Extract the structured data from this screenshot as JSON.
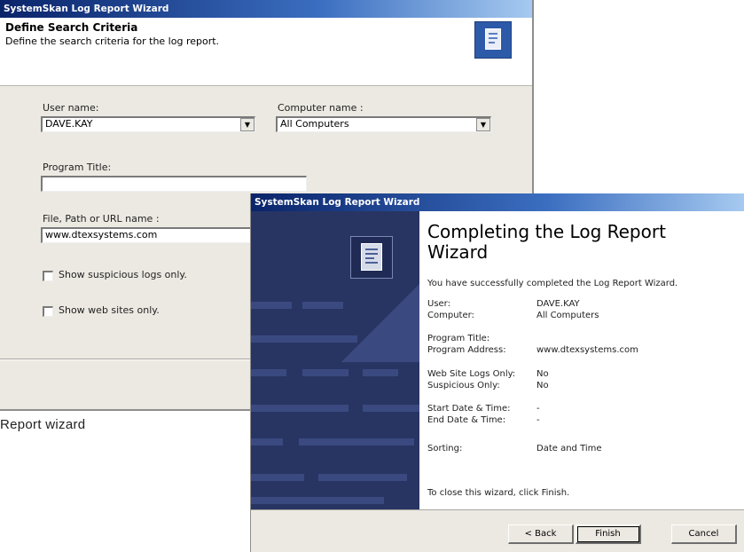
{
  "window1": {
    "title": "SystemSkan Log Report Wizard",
    "heading": "Define Search Criteria",
    "subheading": "Define the search criteria for the log report.",
    "logo_icon": "document-report-icon",
    "user_name": {
      "label": "User name:",
      "value": "DAVE.KAY"
    },
    "computer_name": {
      "label": "Computer name :",
      "value": "All Computers"
    },
    "program_title": {
      "label": "Program Title:",
      "value": ""
    },
    "url_name": {
      "label": "File, Path or URL name :",
      "value": "www.dtexsystems.com"
    },
    "checkboxes": [
      {
        "label": "Show suspicious logs only.",
        "checked": false
      },
      {
        "label": "Show web sites only.",
        "checked": false
      }
    ],
    "dropdown_arrow": "▼"
  },
  "caption": "Report wizard",
  "window2": {
    "title": "SystemSkan Log Report Wizard",
    "heading_line1": "Completing the Log Report",
    "heading_line2": "Wizard",
    "intro": "You have successfully completed the Log Report Wizard.",
    "summary": [
      {
        "label": "User:",
        "value": "DAVE.KAY"
      },
      {
        "label": "Computer:",
        "value": "All Computers"
      },
      {
        "label": "Program Title:",
        "value": ""
      },
      {
        "label": "Program Address:",
        "value": "www.dtexsystems.com"
      },
      {
        "label": "Web Site Logs Only:",
        "value": "No"
      },
      {
        "label": "Suspicious Only:",
        "value": "No"
      },
      {
        "label": "Start Date & Time:",
        "value": "-"
      },
      {
        "label": "End Date & Time:",
        "value": "-"
      },
      {
        "label": "Sorting:",
        "value": "Date and Time"
      }
    ],
    "close_text": "To close this wizard, click Finish.",
    "buttons": {
      "back": "< Back",
      "finish": "Finish",
      "cancel": "Cancel"
    }
  },
  "colors": {
    "titlebar_start": "#0a246a",
    "titlebar_end": "#a6caf0",
    "sidebar": "#283563",
    "dialog_bg": "#ece9e2"
  }
}
